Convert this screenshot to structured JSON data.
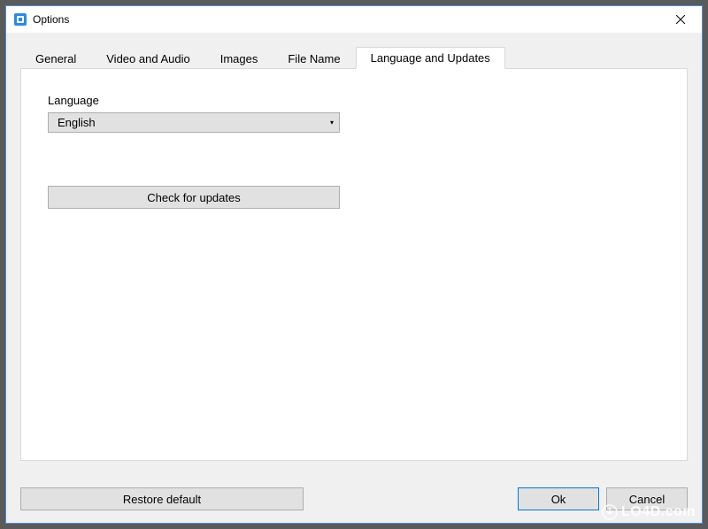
{
  "window": {
    "title": "Options"
  },
  "tabs": [
    {
      "label": "General"
    },
    {
      "label": "Video and Audio"
    },
    {
      "label": "Images"
    },
    {
      "label": "File Name"
    },
    {
      "label": "Language and Updates"
    }
  ],
  "panel": {
    "language_label": "Language",
    "language_value": "English",
    "check_updates_label": "Check for updates"
  },
  "footer": {
    "restore_label": "Restore default",
    "ok_label": "Ok",
    "cancel_label": "Cancel"
  },
  "watermark": {
    "text": "LO4D.com"
  }
}
